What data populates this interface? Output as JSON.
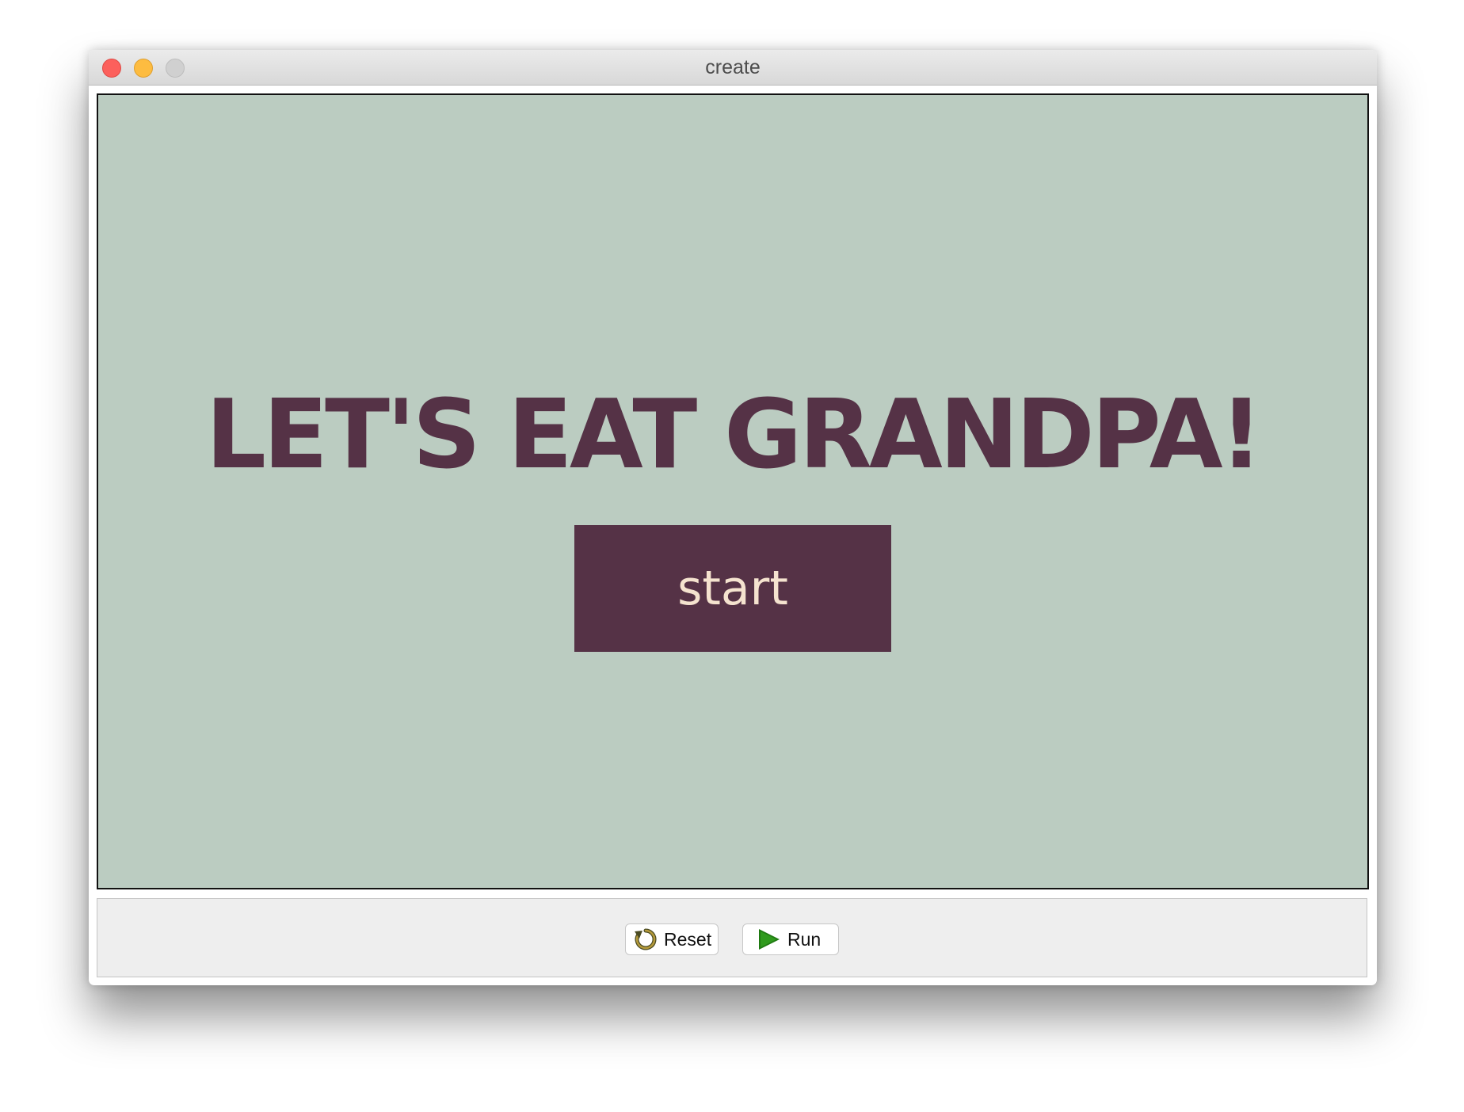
{
  "window": {
    "title": "create"
  },
  "game": {
    "title": "LET'S EAT GRANDPA!",
    "start_label": "start",
    "colors": {
      "background": "#bbccc1",
      "accent": "#553246",
      "button_text": "#f5e3cf"
    }
  },
  "toolbar": {
    "reset_label": "Reset",
    "run_label": "Run",
    "reset_icon": "reset-icon",
    "run_icon": "play-icon"
  }
}
